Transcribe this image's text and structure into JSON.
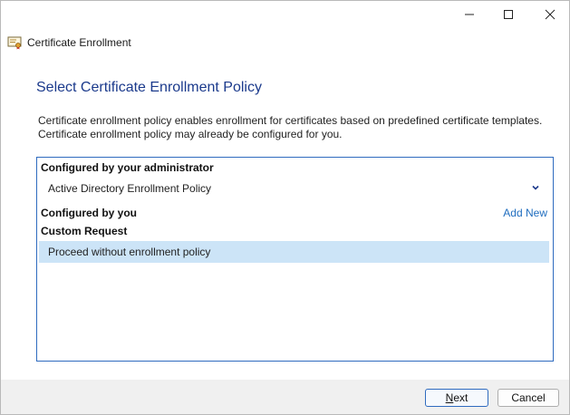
{
  "window": {
    "title": "Certificate Enrollment",
    "controls": {
      "minimize": "minimize-icon",
      "maximize": "maximize-icon",
      "close": "close-icon"
    }
  },
  "page": {
    "heading": "Select Certificate Enrollment Policy",
    "description_line1": "Certificate enrollment policy enables enrollment for certificates based on predefined certificate templates.",
    "description_line2": "Certificate enrollment policy may already be configured for you."
  },
  "policies": {
    "admin_section": "Configured by your administrator",
    "admin_policy": "Active Directory Enrollment Policy",
    "user_section": "Configured by you",
    "add_new": "Add New",
    "custom_section": "Custom Request",
    "custom_policy": "Proceed without enrollment policy"
  },
  "footer": {
    "next_prefix": "",
    "next_underlined": "N",
    "next_rest": "ext",
    "cancel": "Cancel"
  },
  "colors": {
    "heading": "#1b3a8c",
    "link": "#1f6dbf",
    "selection": "#cce4f7",
    "panel_border": "#2f6bbf"
  }
}
